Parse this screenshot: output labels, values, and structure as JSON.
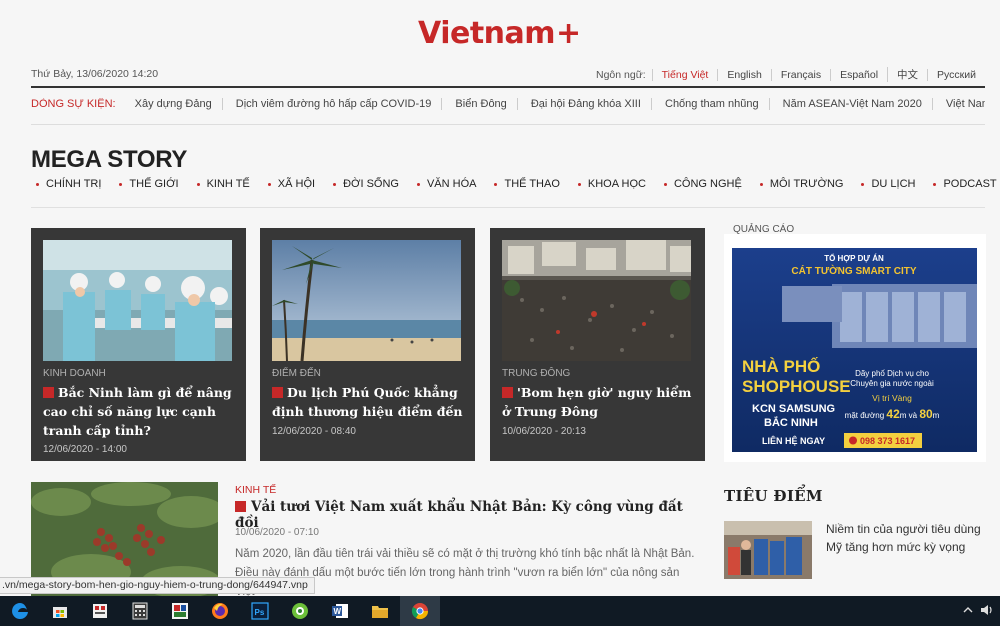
{
  "header": {
    "logo": "Vietnam",
    "logo_plus": "+",
    "date": "Thứ Bảy, 13/06/2020 14:20",
    "language_label": "Ngôn ngữ:",
    "languages": [
      "Tiếng Việt",
      "English",
      "Français",
      "Español",
      "中文",
      "Русский"
    ],
    "active_language": "Tiếng Việt"
  },
  "events": {
    "label": "DÒNG SỰ KIỆN:",
    "items": [
      "Xây dựng Đảng",
      "Dịch viêm đường hô hấp cấp COVID-19",
      "Biển Đông",
      "Đại hội Đảng khóa XIII",
      "Chống tham nhũng",
      "Năm ASEAN-Việt Nam 2020",
      "Việt Nam tham gia"
    ]
  },
  "section": {
    "title": "MEGA STORY",
    "categories": [
      "CHÍNH TRỊ",
      "THẾ GIỚI",
      "KINH TẾ",
      "XÃ HỘI",
      "ĐỜI SỐNG",
      "VĂN HÓA",
      "THỂ THAO",
      "KHOA HỌC",
      "CÔNG NGHỆ",
      "MÔI TRƯỜNG",
      "DU LỊCH",
      "PODCAST"
    ]
  },
  "cards": [
    {
      "category": "KINH DOANH",
      "title": "Bắc Ninh làm gì để nâng cao chỉ số năng lực cạnh tranh cấp tỉnh?",
      "time": "12/06/2020 - 14:00"
    },
    {
      "category": "ĐIỂM ĐẾN",
      "title": "Du lịch Phú Quốc khẳng định thương hiệu điểm đến",
      "time": "12/06/2020 - 08:40"
    },
    {
      "category": "TRUNG ĐÔNG",
      "title": "'Bom hẹn giờ' nguy hiểm ở Trung Đông",
      "time": "10/06/2020 - 20:13"
    }
  ],
  "ad": {
    "label": "QUẢNG CÁO",
    "line1": "TỔ HỢP DỰ ÁN",
    "line2": "CÁT TƯỜNG SMART CITY",
    "big1": "NHÀ PHỐ",
    "big2": "SHOPHOUSE",
    "kcn1": "KCN SAMSUNG",
    "kcn2": "BẮC NINH",
    "right1": "Dãy phố Dịch vụ cho",
    "right2": "Chuyên gia nước ngoài",
    "right3": "Vị trí Vàng",
    "right4a": "mặt đường ",
    "right4b": "42",
    "right4c": "m và ",
    "right4d": "80",
    "right4e": "m",
    "cta": "LIÊN HỆ NGAY",
    "phone": "098 373 1617"
  },
  "lower_article": {
    "category": "KINH TẾ",
    "title": "Vải tươi Việt Nam xuất khẩu Nhật Bản: Kỳ công vùng đất đồi",
    "time": "10/06/2020 - 07:10",
    "desc_line1": "Năm 2020, lần đầu tiên trái vải thiều sẽ có mặt ở thị trường khó tính bậc nhất là Nhật Bản.",
    "desc_line2": "Điều này đánh dấu một bước tiến lớn trong hành trình \"vươn ra biển lớn\" của nông sản Việt"
  },
  "focus": {
    "title": "TIÊU ĐIỂM",
    "item_text": "Niềm tin của người tiêu dùng Mỹ tăng hơn mức kỳ vọng"
  },
  "status_url": ".vn/mega-story-bom-hen-gio-nguy-hiem-o-trung-dong/644947.vnp",
  "colors": {
    "brand": "#c62828",
    "card_bg": "#373737",
    "taskbar": "#101a24"
  }
}
